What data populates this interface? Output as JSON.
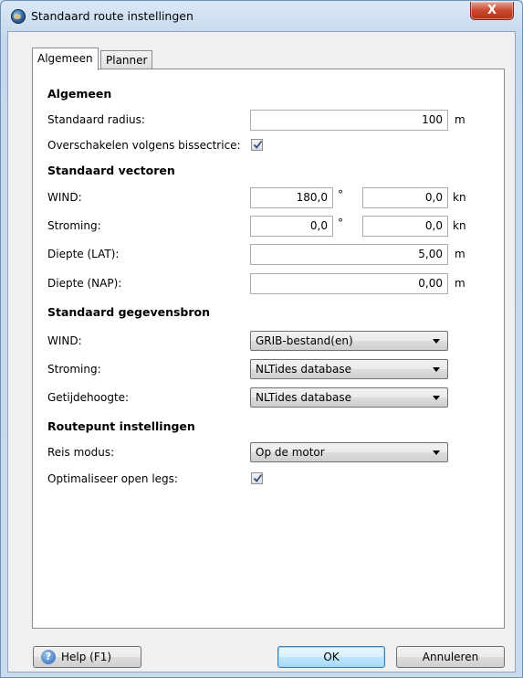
{
  "window": {
    "title": "Standaard route instellingen",
    "close_glyph": "X"
  },
  "tabs": [
    {
      "label": "Algemeen",
      "active": true
    },
    {
      "label": "Planner",
      "active": false
    }
  ],
  "sections": {
    "general": "Algemeen",
    "vectors": "Standaard vectoren",
    "sources": "Standaard gegevensbron",
    "waypoint": "Routepunt instellingen"
  },
  "general": {
    "radius_label": "Standaard radius:",
    "radius_value": "100",
    "radius_unit": "m",
    "bisector_label": "Overschakelen volgens bissectrice:",
    "bisector_checked": true
  },
  "vectors": {
    "wind_label": "WIND:",
    "wind_dir": "180,0",
    "wind_dir_unit": "°",
    "wind_speed": "0,0",
    "wind_speed_unit": "kn",
    "current_label": "Stroming:",
    "current_dir": "0,0",
    "current_dir_unit": "°",
    "current_speed": "0,0",
    "current_speed_unit": "kn",
    "depth_lat_label": "Diepte (LAT):",
    "depth_lat_value": "5,00",
    "depth_lat_unit": "m",
    "depth_nap_label": "Diepte (NAP):",
    "depth_nap_value": "0,00",
    "depth_nap_unit": "m"
  },
  "sources": {
    "wind_label": "WIND:",
    "wind_value": "GRIB-bestand(en)",
    "current_label": "Stroming:",
    "current_value": "NLTides database",
    "tide_label": "Getijdehoogte:",
    "tide_value": "NLTides database"
  },
  "waypoint": {
    "mode_label": "Reis modus:",
    "mode_value": "Op de motor",
    "optimize_label": "Optimaliseer open legs:",
    "optimize_checked": true
  },
  "buttons": {
    "help": "Help (F1)",
    "help_icon": "?",
    "ok": "OK",
    "cancel": "Annuleren"
  },
  "colors": {
    "accent": "#3c7fb1",
    "close": "#c9482f"
  },
  "icons": {
    "app": "globe-icon",
    "help": "help-icon",
    "check": "checkmark-icon",
    "dropdown": "chevron-down-icon"
  }
}
